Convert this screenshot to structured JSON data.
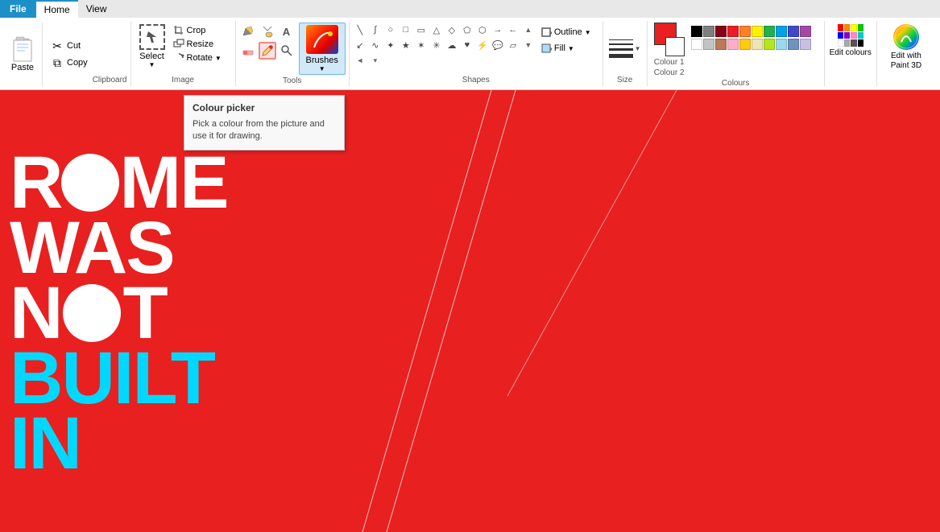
{
  "menubar": {
    "file": "File",
    "home": "Home",
    "view": "View"
  },
  "clipboard": {
    "paste_label": "Paste",
    "cut_label": "Cut",
    "copy_label": "Copy",
    "group_label": "Clipboard"
  },
  "image": {
    "crop_label": "Crop",
    "resize_label": "Resize",
    "rotate_label": "Rotate",
    "select_label": "Select",
    "group_label": "Image"
  },
  "tools": {
    "group_label": "Tools",
    "brushes_label": "Brushes"
  },
  "shapes": {
    "group_label": "Shapes",
    "outline_label": "Outline",
    "fill_label": "Fill"
  },
  "size": {
    "label": "Size"
  },
  "colours": {
    "colour1_label": "Colour 1",
    "colour2_label": "Colour 2",
    "group_label": "Colours"
  },
  "edit_colours": {
    "edit_label": "Edit colours",
    "paint3d_label": "Edit with Paint 3D"
  },
  "tooltip": {
    "title": "Colour picker",
    "text": "Pick a colour from the picture and use it for drawing."
  },
  "palette": {
    "row1": [
      "#000000",
      "#7f7f7f",
      "#880015",
      "#ed1c24",
      "#ff7f27",
      "#fff200",
      "#22b14c",
      "#00a2e8",
      "#3f48cc",
      "#a349a4"
    ],
    "row2": [
      "#ffffff",
      "#c3c3c3",
      "#b97a57",
      "#ffaec9",
      "#ffc90e",
      "#efe4b0",
      "#b5e61d",
      "#99d9ea",
      "#7092be",
      "#c8bfe7"
    ]
  },
  "canvas": {
    "text_line1": "ROME",
    "text_line2": "WAS",
    "text_line3": "NOT",
    "text_line4": "BUILT",
    "text_line5": "IN"
  }
}
